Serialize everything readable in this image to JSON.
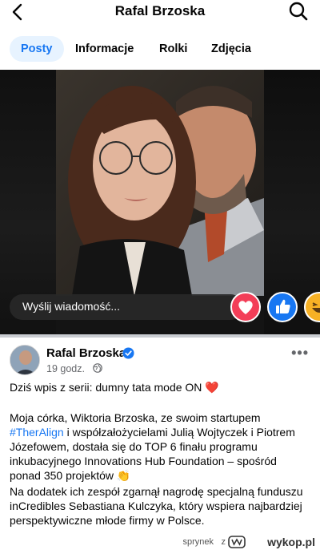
{
  "header": {
    "title": "Rafal Brzoska",
    "back_icon": "chevron-left-icon",
    "search_icon": "search-icon"
  },
  "tabs": [
    {
      "label": "Posty",
      "active": true
    },
    {
      "label": "Informacje",
      "active": false
    },
    {
      "label": "Rolki",
      "active": false
    },
    {
      "label": "Zdjęcia",
      "active": false
    }
  ],
  "story": {
    "message_placeholder": "Wyślij wiadomość...",
    "reactions": [
      "love-icon",
      "like-icon",
      "haha-icon"
    ]
  },
  "post": {
    "author": "Rafal Brzoska",
    "verified": true,
    "time": "19 godz.",
    "audience_icon": "globe-icon",
    "more_icon": "more-options-icon",
    "paragraph1": "Dziś wpis z serii: dumny tata mode ON ❤️",
    "paragraph2_before": "Moja córka, Wiktoria Brzoska, ze swoim startupem ",
    "hashtag": "#TherAlign",
    "paragraph2_after": " i współzałożycielami Julią Wojtyczek i Piotrem Józefowem, dostała się do TOP 6 finału programu inkubacyjnego Innovations Hub Foundation – spośród ponad 350 projektów 👏",
    "paragraph3": "Na dodatek ich zespół zgarnął nagrodę specjalną funduszu inCredibles Sebastiana Kulczyka, który wspiera najbardziej perspektywiczne młode firmy w Polsce."
  },
  "watermark": {
    "user": "sprynek",
    "separator": "z",
    "site": "wykop.pl"
  },
  "colors": {
    "accent": "#1877f2",
    "active_tab_bg": "#e7f3ff",
    "love": "#f33e58",
    "haha": "#f7b125",
    "secondary_text": "#65676b"
  }
}
